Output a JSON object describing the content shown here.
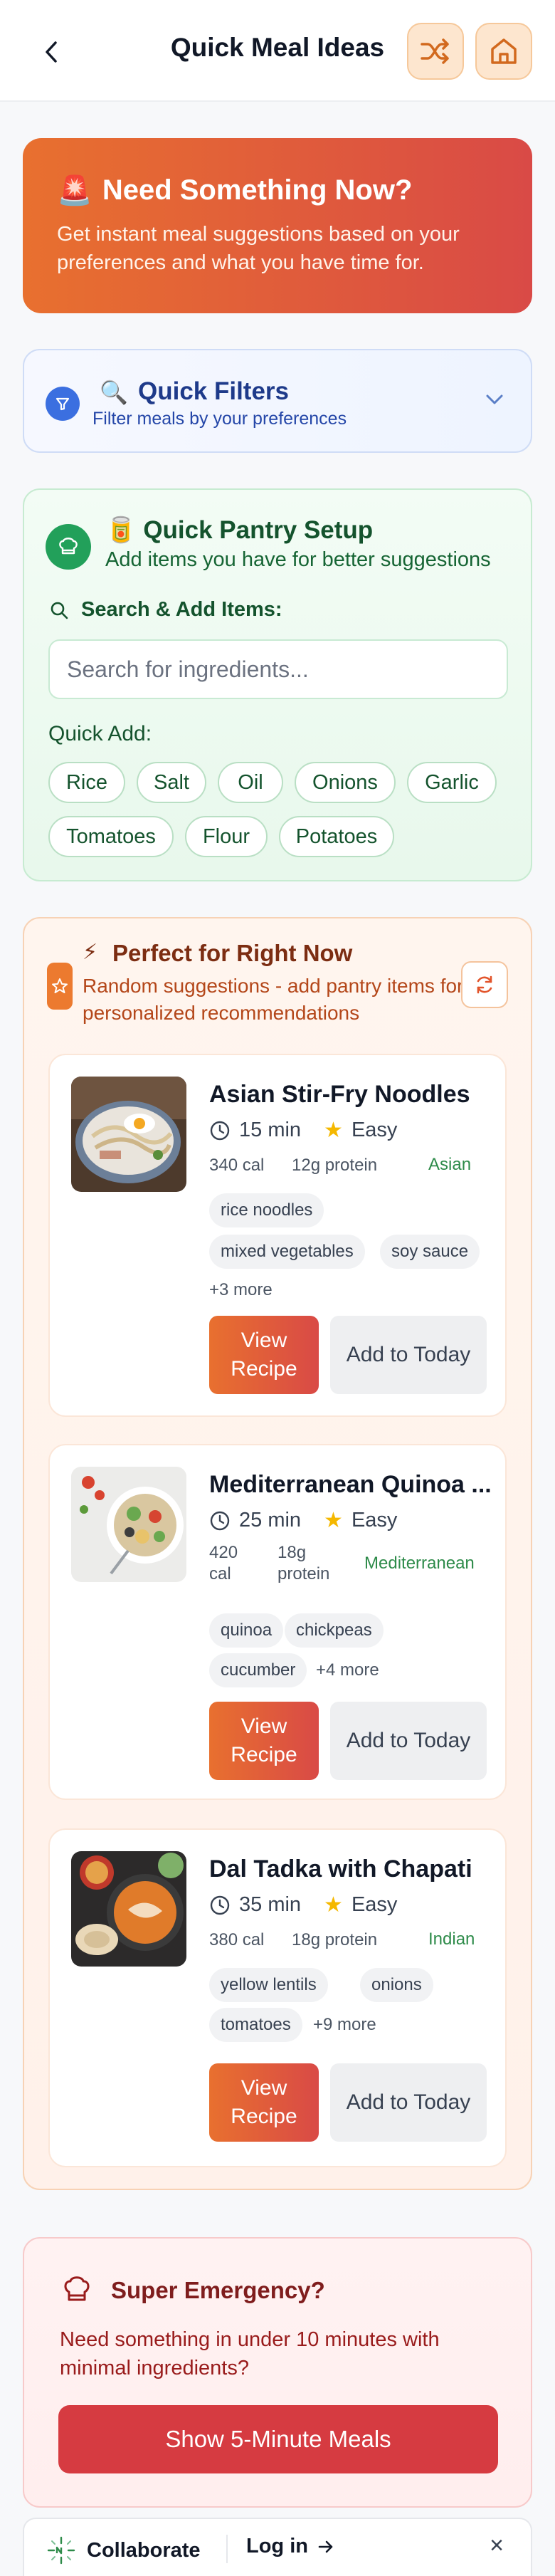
{
  "header": {
    "title": "Quick Meal Ideas",
    "back_icon": "chevron-left-icon",
    "shuffle_icon": "shuffle-icon",
    "home_icon": "home-icon"
  },
  "banner": {
    "emoji": "🚨",
    "title": "Need Something Now?",
    "subtitle": "Get instant meal suggestions based on your preferences and what you have time for."
  },
  "filters": {
    "emoji": "🔍",
    "title": "Quick Filters",
    "subtitle": "Filter meals by your preferences"
  },
  "pantry": {
    "emoji": "🥫",
    "title": "Quick Pantry Setup",
    "subtitle": "Add items you have for better suggestions",
    "search_label": "Search & Add Items:",
    "search_placeholder": "Search for ingredients...",
    "quick_add_label": "Quick Add:",
    "chips": [
      "Rice",
      "Salt",
      "Oil",
      "Onions",
      "Garlic",
      "Tomatoes",
      "Flour",
      "Potatoes"
    ]
  },
  "perfect": {
    "emoji": "⚡",
    "title": "Perfect for Right Now",
    "subtitle": "Random suggestions - add pantry items for personalized recommendations",
    "meals": [
      {
        "title": "Asian Stir-Fry Noodles",
        "time": "15 min",
        "difficulty": "Easy",
        "calories": "340 cal",
        "protein": "12g protein",
        "cuisine": "Asian",
        "ingredients": [
          "rice noodles",
          "mixed vegetables",
          "soy sauce"
        ],
        "more": "+3 more",
        "view_label": "View Recipe",
        "add_label": "Add to Today"
      },
      {
        "title": "Mediterranean Quinoa ...",
        "time": "25 min",
        "difficulty": "Easy",
        "calories": "420 cal",
        "protein": "18g protein",
        "cuisine": "Mediterranean",
        "ingredients": [
          "quinoa",
          "chickpeas",
          "cucumber"
        ],
        "more": "+4 more",
        "view_label": "View Recipe",
        "add_label": "Add to Today"
      },
      {
        "title": "Dal Tadka with Chapati",
        "time": "35 min",
        "difficulty": "Easy",
        "calories": "380 cal",
        "protein": "18g protein",
        "cuisine": "Indian",
        "ingredients": [
          "yellow lentils",
          "onions",
          "tomatoes"
        ],
        "more": "+9 more",
        "view_label": "View Recipe",
        "add_label": "Add to Today"
      }
    ]
  },
  "emergency": {
    "title": "Super Emergency?",
    "subtitle": "Need something in under 10 minutes with minimal ingredients?",
    "button": "Show 5-Minute Meals"
  },
  "bottom_bar": {
    "collaborate": "Collaborate",
    "login": "Log in",
    "close": "×"
  },
  "colors": {
    "accent_orange": "#e8702f",
    "accent_red": "#d94a46",
    "green": "#22a05a",
    "blue": "#3b6fe0"
  }
}
